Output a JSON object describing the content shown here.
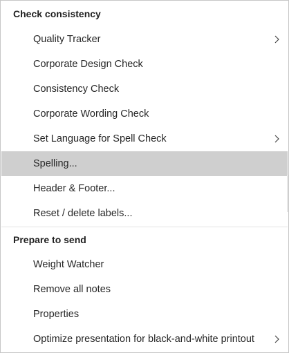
{
  "menu": {
    "sections": [
      {
        "header": "Check consistency",
        "items": [
          {
            "label": "Quality Tracker",
            "has_submenu": true,
            "highlighted": false
          },
          {
            "label": "Corporate Design Check",
            "has_submenu": false,
            "highlighted": false
          },
          {
            "label": "Consistency Check",
            "has_submenu": false,
            "highlighted": false
          },
          {
            "label": "Corporate Wording Check",
            "has_submenu": false,
            "highlighted": false
          },
          {
            "label": "Set Language for Spell Check",
            "has_submenu": true,
            "highlighted": false
          },
          {
            "label": "Spelling...",
            "has_submenu": false,
            "highlighted": true
          },
          {
            "label": "Header & Footer...",
            "has_submenu": false,
            "highlighted": false
          },
          {
            "label": "Reset / delete labels...",
            "has_submenu": false,
            "highlighted": false
          }
        ]
      },
      {
        "header": "Prepare to send",
        "items": [
          {
            "label": "Weight Watcher",
            "has_submenu": false,
            "highlighted": false
          },
          {
            "label": "Remove all notes",
            "has_submenu": false,
            "highlighted": false
          },
          {
            "label": "Properties",
            "has_submenu": false,
            "highlighted": false
          },
          {
            "label": "Optimize presentation for black-and-white printout",
            "has_submenu": true,
            "highlighted": false
          }
        ]
      }
    ],
    "icons": {
      "submenu": "chevron-right-icon"
    },
    "colors": {
      "highlight": "#cfcfcf",
      "border": "#c6c6c6",
      "text": "#262626"
    }
  }
}
